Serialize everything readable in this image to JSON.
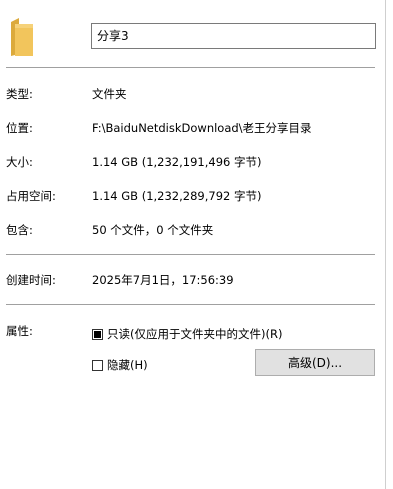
{
  "header": {
    "name_value": "分享3"
  },
  "rows": {
    "type": {
      "label": "类型:",
      "value": "文件夹"
    },
    "location": {
      "label": "位置:",
      "value": "F:\\BaiduNetdiskDownload\\老王分享目录"
    },
    "size": {
      "label": "大小:",
      "value": "1.14 GB (1,232,191,496 字节)"
    },
    "disk": {
      "label": "占用空间:",
      "value": "1.14 GB (1,232,289,792 字节)"
    },
    "contains": {
      "label": "包含:",
      "value": "50 个文件，0 个文件夹"
    },
    "created": {
      "label": "创建时间:",
      "value": "2025年7月1日，17:56:39"
    }
  },
  "attributes": {
    "label": "属性:",
    "readonly": {
      "label": "只读(仅应用于文件夹中的文件)(R)",
      "state": "indeterminate"
    },
    "hidden": {
      "label": "隐藏(H)",
      "state": "unchecked"
    },
    "advanced_button": "高级(D)..."
  },
  "colors": {
    "folder": "#f2c55c",
    "folder_dark": "#dcaa3c",
    "button_bg": "#e1e1e1"
  }
}
